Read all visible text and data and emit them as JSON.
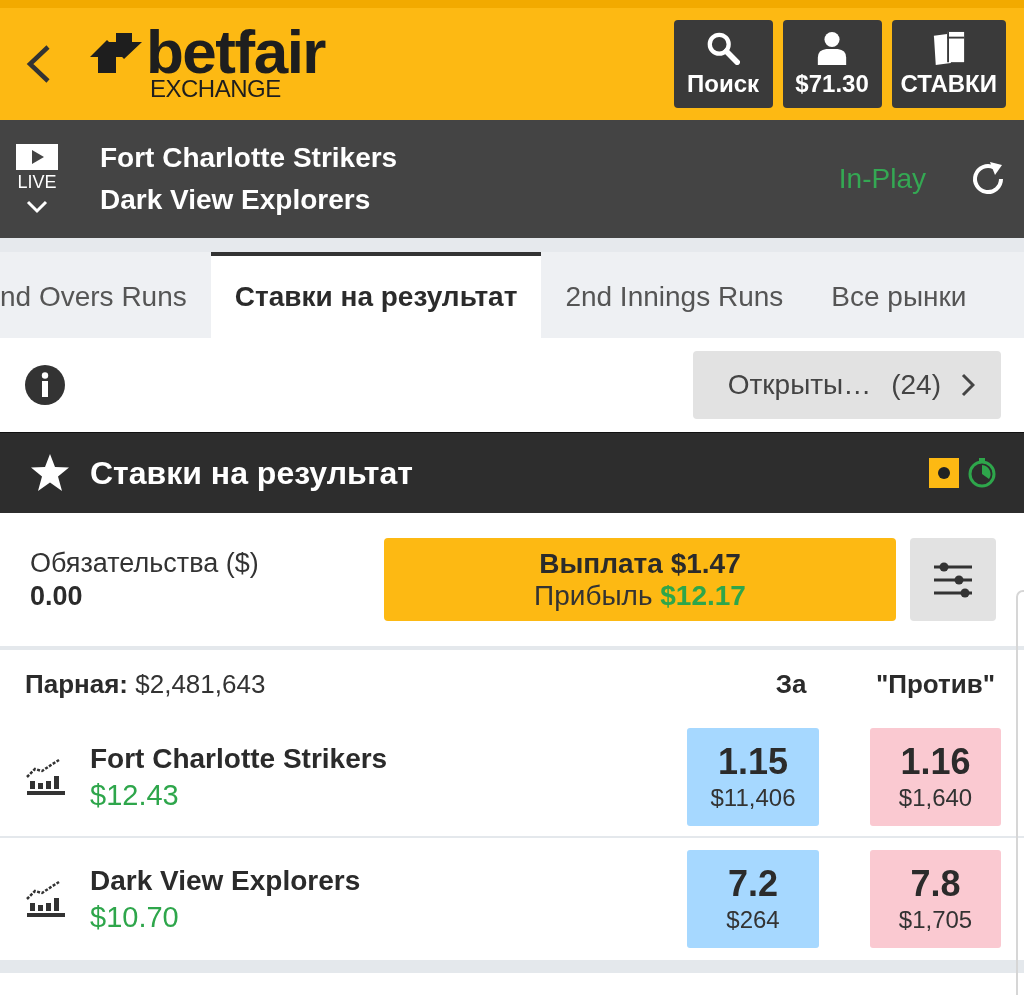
{
  "header": {
    "logo": {
      "brand": "betfair",
      "product": "EXCHANGE"
    },
    "buttons": [
      {
        "label": "Поиск",
        "kind": "search"
      },
      {
        "label": "$71.30",
        "kind": "account"
      },
      {
        "label": "СТАВКИ",
        "kind": "bets"
      }
    ]
  },
  "event": {
    "live_label": "LIVE",
    "teams": [
      "Fort Charlotte Strikers",
      "Dark View Explorers"
    ],
    "status": "In-Play"
  },
  "tabs": [
    {
      "label": "nd Overs Runs",
      "selected": false
    },
    {
      "label": "Ставки на результат",
      "selected": true
    },
    {
      "label": "2nd Innings Runs",
      "selected": false
    },
    {
      "label": "Все рынки",
      "selected": false
    }
  ],
  "open_bets_button": {
    "label": "Открыты…",
    "count": "(24)"
  },
  "market": {
    "title": "Ставки на результат"
  },
  "liability": {
    "label": "Обязательства ($)",
    "value": "0.00"
  },
  "cash_out": {
    "payout": "Выплата $1.47",
    "profit": "Прибыль **$12.17**"
  },
  "runners_header": {
    "matched": "**Парная:** $2,481,643",
    "back": "За",
    "lay": "\"Против\""
  },
  "runners": [
    {
      "name": "Fort Charlotte Strikers",
      "pnl": "$12.43",
      "back": {
        "odds": "1.15",
        "amount": "$11,406"
      },
      "lay": {
        "odds": "1.16",
        "amount": "$1,640"
      }
    },
    {
      "name": "Dark View Explorers",
      "pnl": "$10.70",
      "back": {
        "odds": "7.2",
        "amount": "$264"
      },
      "lay": {
        "odds": "7.8",
        "amount": "$1,705"
      }
    }
  ]
}
